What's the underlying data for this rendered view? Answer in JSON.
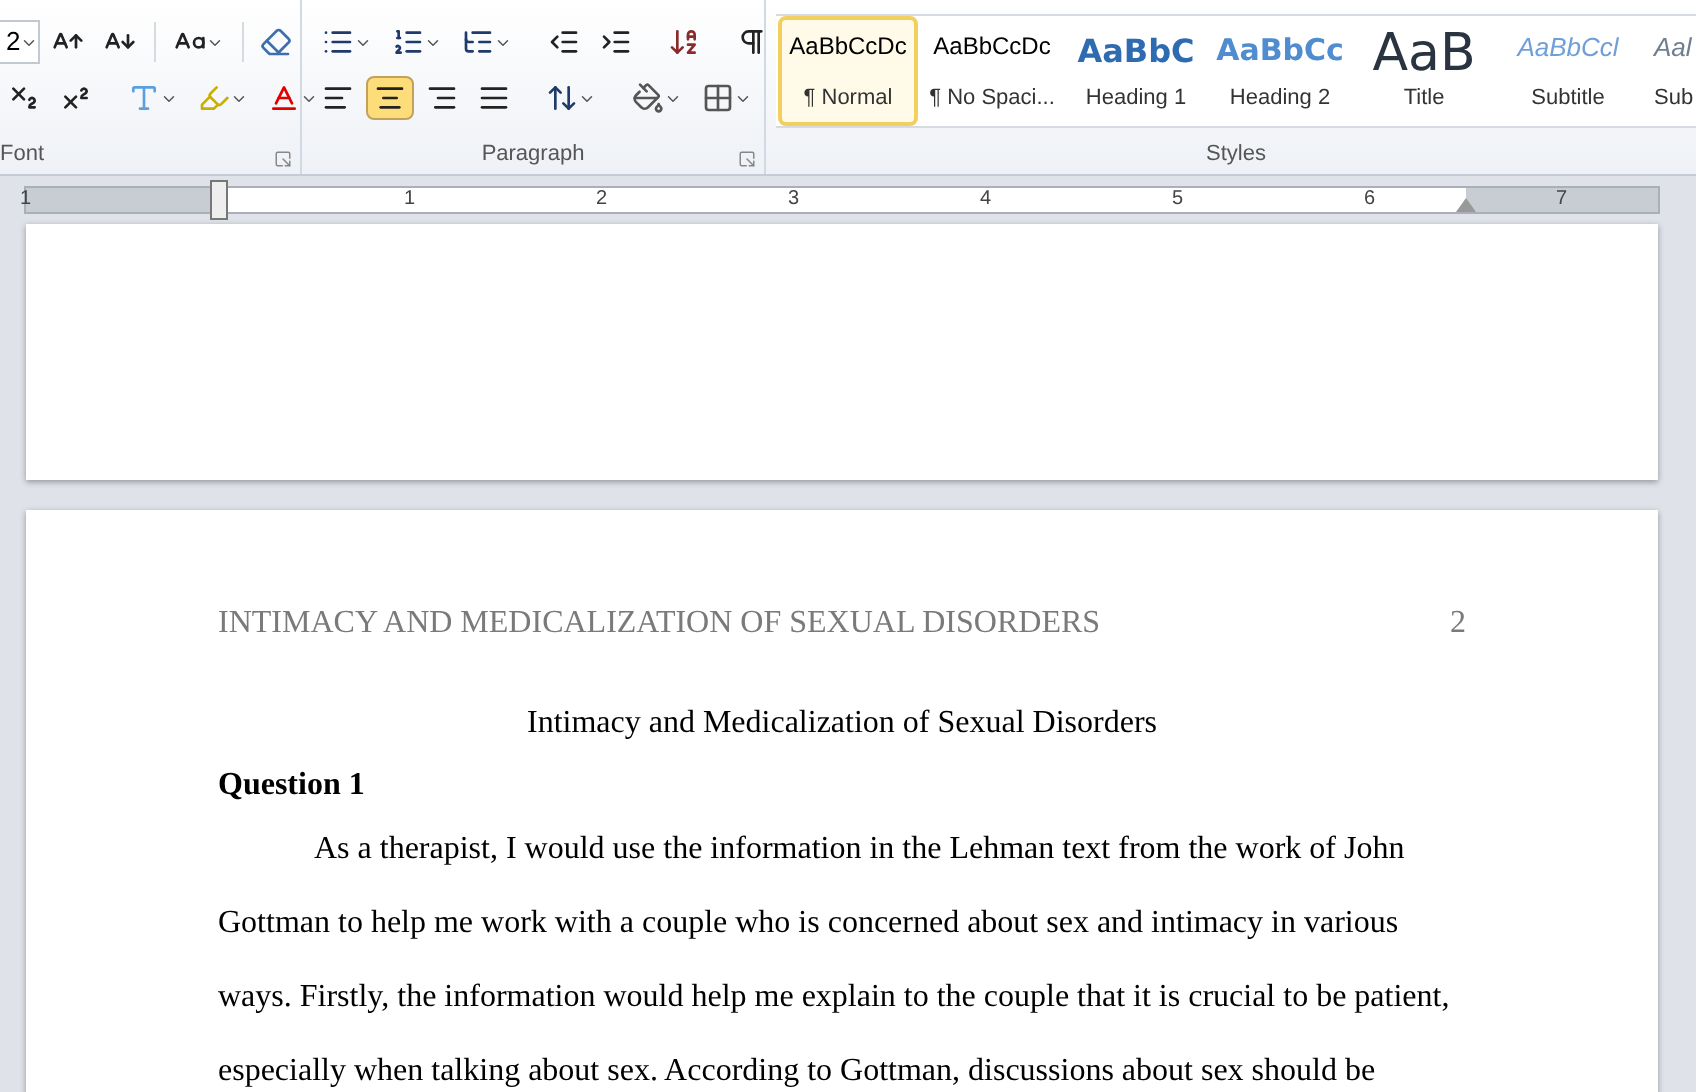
{
  "ribbon": {
    "font": {
      "size_value": "2",
      "label": "Font"
    },
    "paragraph": {
      "label": "Paragraph",
      "alignment": [
        {
          "kind": "left",
          "selected": false
        },
        {
          "kind": "center",
          "selected": true
        },
        {
          "kind": "right",
          "selected": false
        },
        {
          "kind": "justify",
          "selected": false
        }
      ]
    },
    "styles": {
      "label": "Styles",
      "items": [
        {
          "kind": "normal",
          "preview": "AaBbCcDc",
          "label": "¶ Normal",
          "selected": true
        },
        {
          "kind": "normal",
          "preview": "AaBbCcDc",
          "label": "¶ No Spaci...",
          "selected": false
        },
        {
          "kind": "heading1",
          "preview": "AaBbC",
          "label": "Heading 1",
          "selected": false
        },
        {
          "kind": "heading2",
          "preview": "AaBbCc",
          "label": "Heading 2",
          "selected": false
        },
        {
          "kind": "title",
          "preview": "AaB",
          "label": "Title",
          "selected": false
        },
        {
          "kind": "subtitle",
          "preview": "AaBbCcl",
          "label": "Subtitle",
          "selected": false
        },
        {
          "kind": "subtle",
          "preview": "Aal",
          "label": "Sub",
          "selected": false
        }
      ]
    }
  },
  "ruler": {
    "numbers": [
      "1",
      "1",
      "2",
      "3",
      "4",
      "5",
      "6",
      "7"
    ]
  },
  "document": {
    "header": "INTIMACY AND MEDICALIZATION OF SEXUAL DISORDERS",
    "page_number": "2",
    "title": "Intimacy and Medicalization of Sexual Disorders",
    "heading": "Question 1",
    "paragraph": "As a therapist, I would use the information in the Lehman text from the work of John Gottman to help me work with a couple who is concerned about sex and intimacy in various ways. Firstly, the information would help me explain to the couple that it is crucial to be patient, especially when talking about sex. According to Gottman, discussions about sex should be"
  }
}
